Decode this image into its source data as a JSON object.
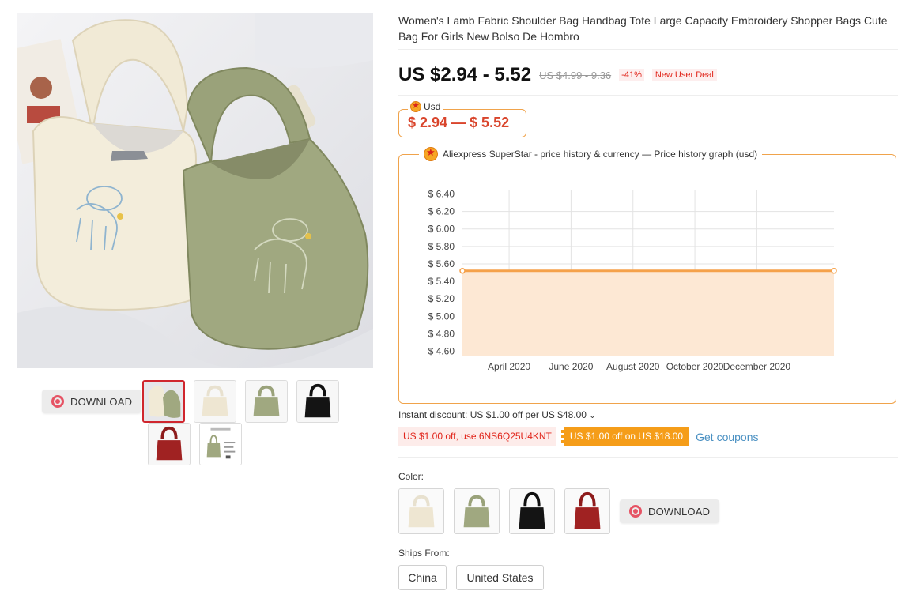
{
  "product": {
    "title": "Women's Lamb Fabric Shoulder Bag Handbag Tote Large Capacity Embroidery Shopper Bags Cute Bag For Girls New Bolso De Hombro",
    "price_range": "US $2.94 - 5.52",
    "old_price_range": "US $4.99 - 9.36",
    "discount": "-41%",
    "deal_badge": "New User Deal"
  },
  "gallery": {
    "download_label": "DOWNLOAD",
    "thumbnails": [
      "bags-pair",
      "cream-bag",
      "green-bag",
      "black-bag",
      "red-bag",
      "size-chart"
    ],
    "active_index": 0
  },
  "currency_widget": {
    "label": "Usd",
    "value": "$ 2.94 — $ 5.52"
  },
  "price_graph": {
    "legend": "Aliexpress SuperStar - price history & currency — Price history graph (usd)"
  },
  "chart_data": {
    "type": "area",
    "title": "",
    "xlabel": "",
    "ylabel": "",
    "y_ticks": [
      "$ 6.40",
      "$ 6.20",
      "$ 6.00",
      "$ 5.80",
      "$ 5.60",
      "$ 5.40",
      "$ 5.20",
      "$ 5.00",
      "$ 4.80",
      "$ 4.60"
    ],
    "x_ticks": [
      "April 2020",
      "June 2020",
      "August 2020",
      "October 2020",
      "December 2020"
    ],
    "ylim": [
      4.55,
      6.45
    ],
    "xlim": [
      "2020-02-15",
      "2021-02-15"
    ],
    "series": [
      {
        "x": [
          "2020-02-15",
          "2021-02-15"
        ],
        "values": [
          5.52,
          5.52
        ]
      }
    ],
    "grid": true,
    "colors": {
      "line": "#f5a14a",
      "fill": "#fde8d4"
    }
  },
  "discounts": {
    "instant": "Instant discount: US $1.00 off per US $48.00",
    "coupon_code": "US $1.00 off, use 6NS6Q25U4KNT",
    "coupon_store": "US $1.00 off on US $18.00",
    "get_coupons": "Get coupons"
  },
  "color_picker": {
    "label": "Color:",
    "options": [
      "cream",
      "green",
      "black",
      "red"
    ],
    "download_label": "DOWNLOAD"
  },
  "shipping": {
    "label": "Ships From:",
    "options": [
      "China",
      "United States"
    ]
  },
  "colors": {
    "accent_red": "#e1251b",
    "orange": "#f59d19",
    "link_blue": "#4a90c2"
  }
}
